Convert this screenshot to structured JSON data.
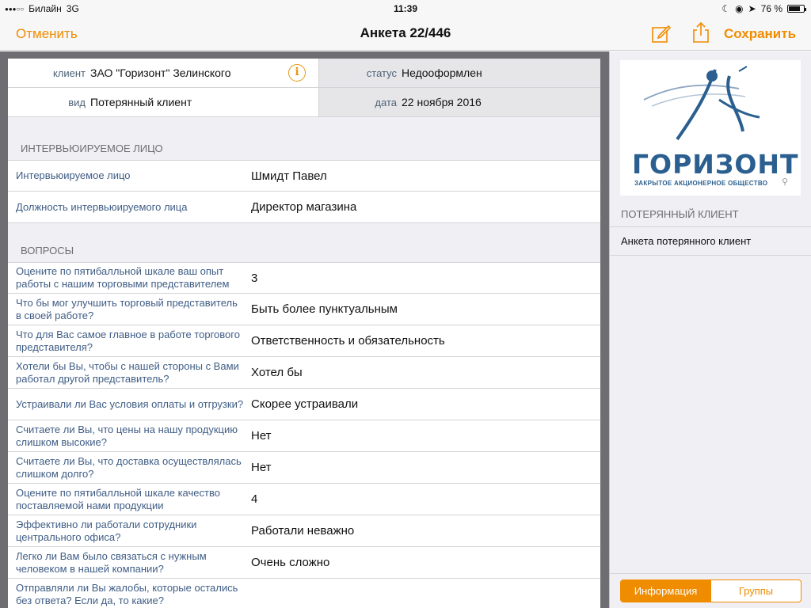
{
  "statusbar": {
    "carrier": "Билайн",
    "network": "3G",
    "time": "11:39",
    "battery": "76 %",
    "battery_level": 0.76
  },
  "navbar": {
    "cancel": "Отменить",
    "title": "Анкета 22/446",
    "save": "Сохранить",
    "edit_icon": "compose-icon",
    "share_icon": "share-icon"
  },
  "header": {
    "client_label": "клиент",
    "client_value": "ЗАО \"Горизонт\" Зелинского",
    "status_label": "статус",
    "status_value": "Недооформлен",
    "kind_label": "вид",
    "kind_value": "Потерянный клиент",
    "date_label": "дата",
    "date_value": "22 ноября 2016"
  },
  "interviewee": {
    "section_title": "ИНТЕРВЬЮИРУЕМОЕ ЛИЦО",
    "rows": [
      {
        "q": "Интервьюируемое лицо",
        "a": "Шмидт Павел"
      },
      {
        "q": "Должность интервьюируемого лица",
        "a": "Директор магазина"
      }
    ]
  },
  "questions": {
    "section_title": "ВОПРОСЫ",
    "rows": [
      {
        "q": "Оцените по пятибалльной шкале ваш опыт работы с нашим торговыми представителем",
        "a": "3"
      },
      {
        "q": "Что бы мог улучшить торговый представитель в своей работе?",
        "a": "Быть более пунктуальным"
      },
      {
        "q": "Что для Вас самое главное в работе торгового представителя?",
        "a": "Ответственность и обязательность"
      },
      {
        "q": "Хотели бы Вы, чтобы с нашей стороны с Вами работал другой представитель?",
        "a": "Хотел бы"
      },
      {
        "q": "Устраивали ли Вас условия оплаты и отгрузки?",
        "a": "Скорее устраивали"
      },
      {
        "q": "Считаете ли Вы, что цены на нашу продукцию слишком высокие?",
        "a": "Нет"
      },
      {
        "q": "Считаете ли Вы, что доставка осуществлялась слишком долго?",
        "a": "Нет"
      },
      {
        "q": "Оцените по пятибалльной шкале качество поставляемой нами продукции",
        "a": "4"
      },
      {
        "q": "Эффективно ли работали сотрудники центрального офиса?",
        "a": "Работали неважно"
      },
      {
        "q": "Легко ли Вам было связаться с нужным человеком в нашей компании?",
        "a": "Очень сложно"
      },
      {
        "q": "Отправляли ли Вы жалобы, которые остались без ответа? Если да, то какие?",
        "a": ""
      }
    ]
  },
  "sidebar": {
    "logo_word": "ГОРИЗОНТ",
    "logo_sub": "ЗАКРЫТОЕ АКЦИОНЕРНОЕ ОБЩЕСТВО",
    "section_title": "ПОТЕРЯННЫЙ КЛИЕНТ",
    "item": "Анкета потерянного клиент",
    "tabs": [
      "Информация",
      "Группы"
    ],
    "active_tab": "Информация"
  },
  "colors": {
    "accent": "#f08c00",
    "question_text": "#3f5d85",
    "logo_blue": "#2a5f8f"
  }
}
